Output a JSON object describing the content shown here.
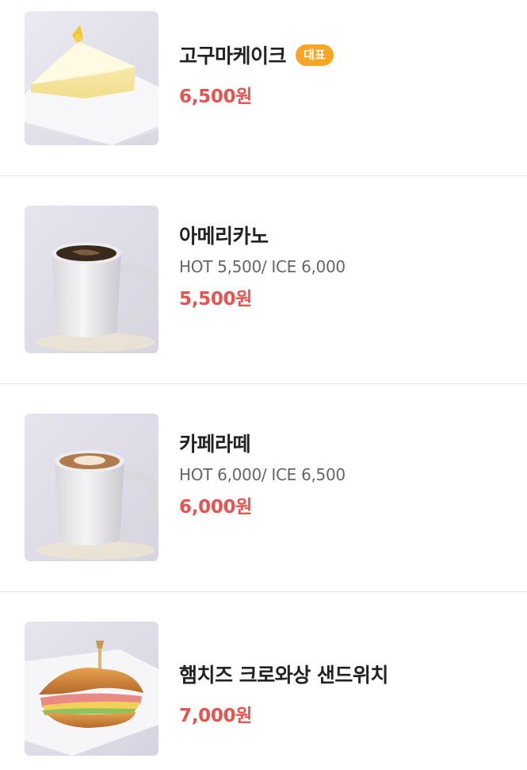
{
  "menu": {
    "items": [
      {
        "name": "고구마케이크",
        "badge": "대표",
        "price": "6,500원",
        "image_icon": "sweet-potato-cake-photo"
      },
      {
        "name": "아메리카노",
        "description": "HOT 5,500/ ICE 6,000",
        "price": "5,500원",
        "image_icon": "americano-mug-photo"
      },
      {
        "name": "카페라떼",
        "description": "HOT 6,000/ ICE 6,500",
        "price": "6,000원",
        "image_icon": "cafe-latte-mug-photo"
      },
      {
        "name": "햄치즈 크로와상 샌드위치",
        "price": "7,000원",
        "image_icon": "ham-cheese-croissant-photo"
      }
    ]
  },
  "colors": {
    "price": "#e8534f",
    "badge": "#f6a623",
    "divider": "#e6e6e6",
    "description": "#666666"
  }
}
